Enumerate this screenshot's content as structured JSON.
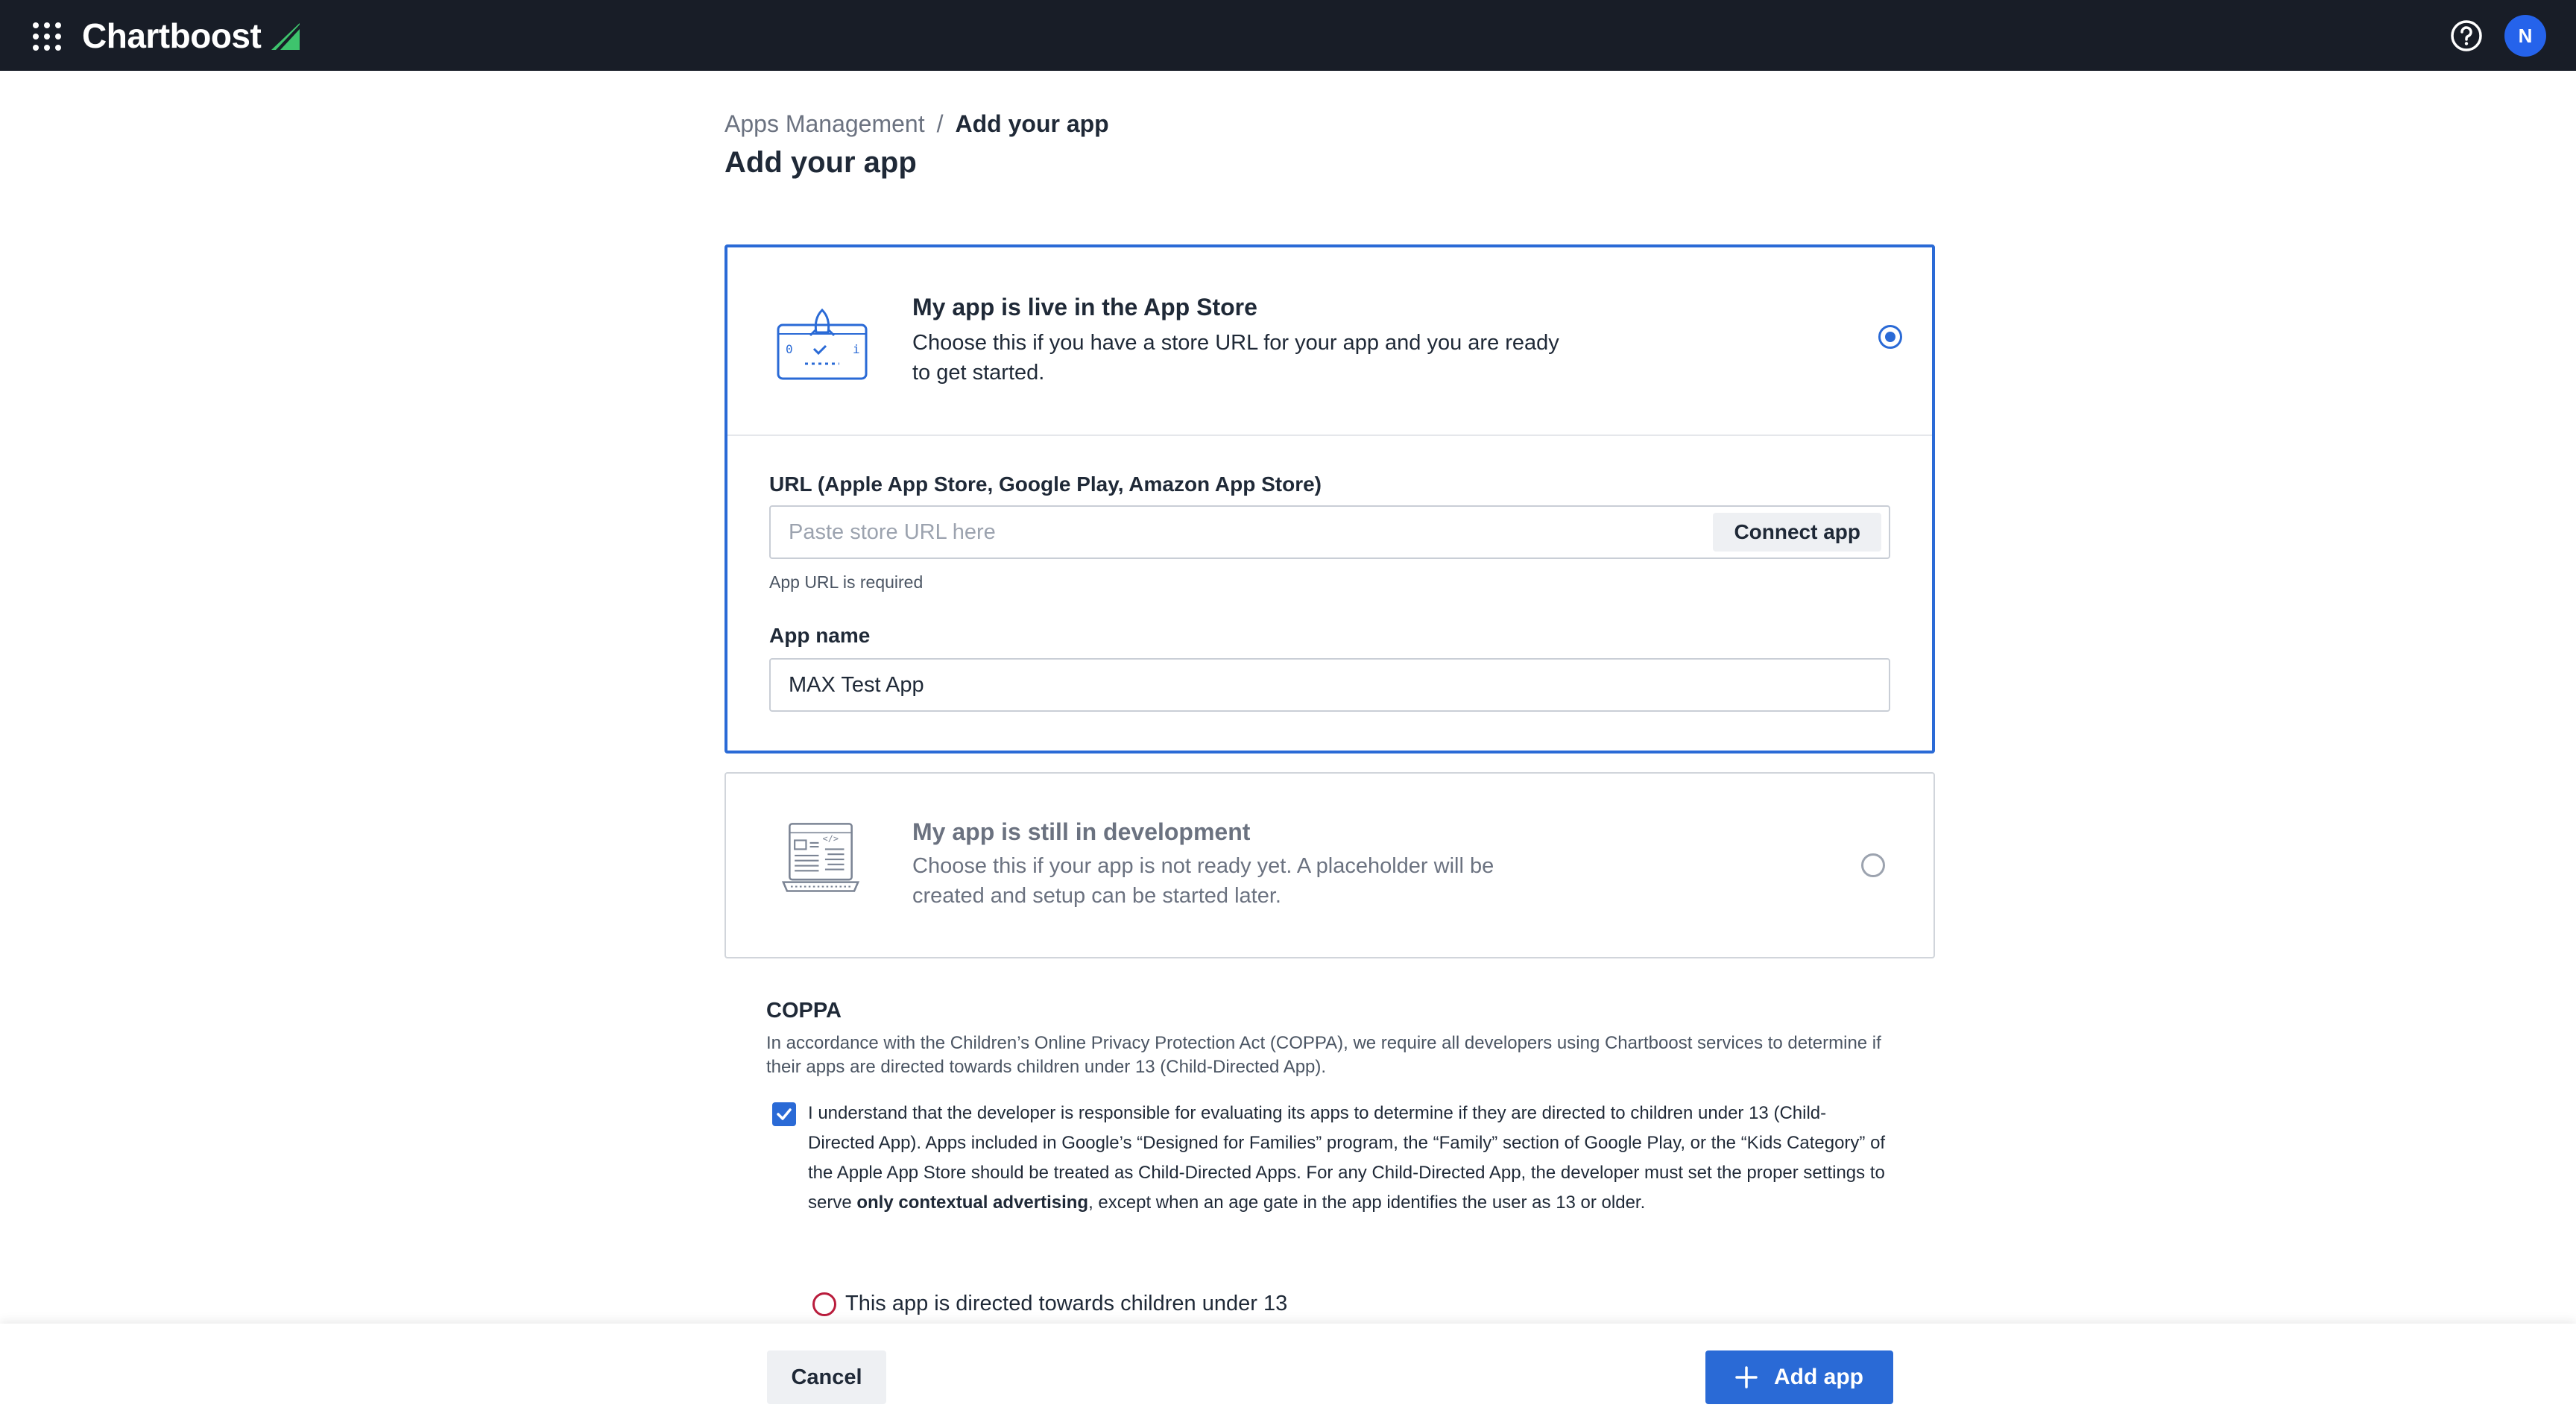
{
  "app": {
    "brand_name": "Chartboost",
    "avatar_initial": "N"
  },
  "icons": {
    "apps_menu": "apps-grid-icon",
    "brand_logo": "chartboost-logo-icon",
    "help": "help-circle-icon",
    "live_option": "rocket-screen-icon",
    "dev_option": "laptop-code-icon",
    "check": "checkmark-icon",
    "add": "plus-icon"
  },
  "colors": {
    "topbar": "#181d27",
    "accent": "#2a6ad6",
    "brand_green": "#3ec46d",
    "error_red": "#b91c3c"
  },
  "breadcrumb": {
    "parent": "Apps Management",
    "separator": "/",
    "current": "Add your app"
  },
  "page": {
    "title": "Add your app"
  },
  "options": {
    "live": {
      "title": "My app is live in the App Store",
      "description": "Choose this if you have a store URL for your app and you are ready to get started.",
      "selected": true
    },
    "dev": {
      "title": "My app is still in development",
      "description": "Choose this if your app is not ready yet. A placeholder will be created and setup can be started later.",
      "selected": false
    }
  },
  "form": {
    "url_label": "URL (Apple App Store, Google Play, Amazon App Store)",
    "url_placeholder": "Paste store URL here",
    "url_value": "",
    "connect_label": "Connect app",
    "url_hint": "App URL is required",
    "name_label": "App name",
    "name_value": "MAX Test App"
  },
  "coppa": {
    "title": "COPPA",
    "description": "In accordance with the Children’s Online Privacy Protection Act (COPPA), we require all developers using Chartboost services to determine if their apps are directed towards children under 13 (Child-Directed App).",
    "consent_part1": "I understand that the developer is responsible for evaluating its apps to determine if they are directed to children under 13 (Child-Directed App). Apps included in Google’s “Designed for Families” program, the “Family” section of Google Play, or the “Kids Category” of the Apple App Store should be treated as Child-Directed Apps. For any Child-Directed App, the developer must set the proper settings to serve ",
    "consent_bold": "only contextual advertising",
    "consent_part2": ", except when an age gate in the app identifies the user as 13 or older.",
    "consent_checked": true,
    "child_directed_label": "This app is directed towards children under 13"
  },
  "footer": {
    "cancel_label": "Cancel",
    "add_label": "Add app"
  }
}
